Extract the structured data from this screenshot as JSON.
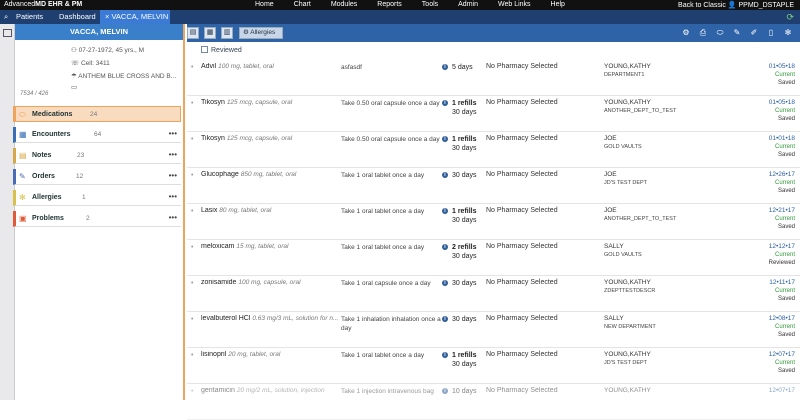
{
  "topbar": {
    "logo_prefix": "Advanced",
    "logo_brand": "MD EHR & PM",
    "nav": [
      "Home",
      "Chart",
      "Modules",
      "Reports",
      "Tools",
      "Admin",
      "Web Links",
      "Help"
    ],
    "right_text": "Back to Classic  👤 PPMD_DSTAPLE"
  },
  "tabs": {
    "patients": "Patients",
    "dashboard": "Dashboard",
    "active": "VACCA, MELVIN",
    "close": "×"
  },
  "patient": {
    "name": "VACCA, MELVIN",
    "dob": "07-27-1972, 45 yrs., M",
    "cell": "Cell: 3411",
    "insurance": "ANTHEM BLUE CROSS AND B...",
    "id": "7534 / 426"
  },
  "sections": [
    {
      "label": "Medications",
      "count": "24",
      "icon": "pill-icon",
      "color": "#f0a35a",
      "active": true
    },
    {
      "label": "Encounters",
      "count": "64",
      "icon": "calendar-icon",
      "color": "#3a6fb5"
    },
    {
      "label": "Notes",
      "count": "23",
      "icon": "notes-icon",
      "color": "#d7a84a"
    },
    {
      "label": "Orders",
      "count": "12",
      "icon": "orders-icon",
      "color": "#4a6bb5"
    },
    {
      "label": "Allergies",
      "count": "1",
      "icon": "allergy-icon",
      "color": "#d8c04a"
    },
    {
      "label": "Problems",
      "count": "2",
      "icon": "problems-icon",
      "color": "#e05a3a"
    }
  ],
  "toolbar": {
    "allergies_label": "Allergies",
    "reviewed_label": "Reviewed"
  },
  "medications": [
    {
      "name": "Advil",
      "detail": "100 mg, tablet, oral",
      "sig": "asfasdf",
      "refills": "",
      "duration": "5 days",
      "pharmacy": "No Pharmacy Selected",
      "provider": "YOUNG,KATHY",
      "dept": "DEPARTMENT1",
      "date": "01•05•18",
      "status": "Current",
      "state": "Saved"
    },
    {
      "name": "Tikosyn",
      "detail": "125 mcg, capsule, oral",
      "sig": "Take 0.50 oral capsule once a day",
      "refills": "1 refills",
      "duration": "30 days",
      "pharmacy": "No Pharmacy Selected",
      "provider": "YOUNG,KATHY",
      "dept": "ANOTHER_DEPT_TO_TEST",
      "date": "01•05•18",
      "status": "Current",
      "state": "Saved"
    },
    {
      "name": "Tikosyn",
      "detail": "125 mcg, capsule, oral",
      "sig": "Take 0.50 oral capsule once a day",
      "refills": "1 refills",
      "duration": "30 days",
      "pharmacy": "No Pharmacy Selected",
      "provider": "JOE",
      "dept": "GOLD VAULTS",
      "date": "01•01•18",
      "status": "Current",
      "state": "Saved"
    },
    {
      "name": "Glucophage",
      "detail": "850 mg, tablet, oral",
      "sig": "Take 1 oral tablet once a day",
      "refills": "",
      "duration": "30 days",
      "pharmacy": "No Pharmacy Selected",
      "provider": "JOE",
      "dept": "JD'S TEST DEPT",
      "date": "12•26•17",
      "status": "Current",
      "state": "Saved"
    },
    {
      "name": "Lasix",
      "detail": "80 mg, tablet, oral",
      "sig": "Take 1 oral tablet once a day",
      "refills": "1 refills",
      "duration": "30 days",
      "pharmacy": "No Pharmacy Selected",
      "provider": "JOE",
      "dept": "ANOTHER_DEPT_TO_TEST",
      "date": "12•21•17",
      "status": "Current",
      "state": "Saved"
    },
    {
      "name": "meloxicam",
      "detail": "15 mg, tablet, oral",
      "sig": "Take 1 oral tablet once a day",
      "refills": "2 refills",
      "duration": "30 days",
      "pharmacy": "No Pharmacy Selected",
      "provider": "SALLY",
      "dept": "GOLD VAULTS",
      "date": "12•12•17",
      "status": "Current",
      "state": "Reviewed"
    },
    {
      "name": "zonisamide",
      "detail": "100 mg, capsule, oral",
      "sig": "Take 1 oral capsule once a day",
      "refills": "",
      "duration": "30 days",
      "pharmacy": "No Pharmacy Selected",
      "provider": "YOUNG,KATHY",
      "dept": "ZDEPTTESTDESCR",
      "date": "12•11•17",
      "status": "Current",
      "state": "Saved"
    },
    {
      "name": "levalbuterol HCl",
      "detail": "0.63 mg/3 mL, solution for n...",
      "sig": "Take 1 inhalation inhalation once a day",
      "refills": "",
      "duration": "30 days",
      "pharmacy": "No Pharmacy Selected",
      "provider": "SALLY",
      "dept": "NEW DEPARTMENT",
      "date": "12•08•17",
      "status": "Current",
      "state": "Saved"
    },
    {
      "name": "lisinopril",
      "detail": "20 mg, tablet, oral",
      "sig": "Take 1 oral tablet once a day",
      "refills": "1 refills",
      "duration": "30 days",
      "pharmacy": "No Pharmacy Selected",
      "provider": "YOUNG,KATHY",
      "dept": "JD'S TEST DEPT",
      "date": "12•07•17",
      "status": "Current",
      "state": "Saved"
    },
    {
      "name": "gentamicin",
      "detail": "20 mg/2 mL, solution, injection",
      "sig": "Take 1 injection intravenous bag",
      "refills": "",
      "duration": "10 days",
      "pharmacy": "No Pharmacy Selected",
      "provider": "YOUNG,KATHY",
      "dept": "",
      "date": "12•07•17",
      "status": "",
      "state": "",
      "faded": true
    }
  ]
}
